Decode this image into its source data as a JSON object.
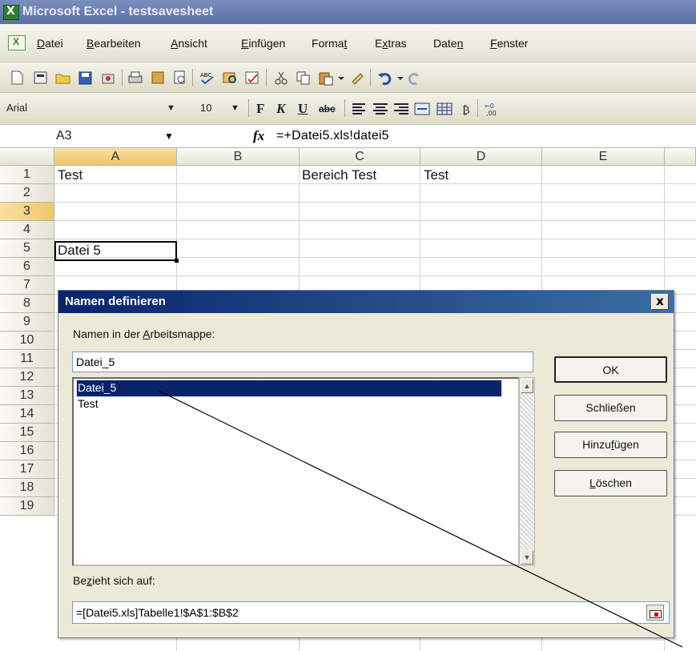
{
  "window": {
    "title": "Microsoft Excel - testsavesheet"
  },
  "menu": {
    "items": [
      {
        "pre": "",
        "key": "D",
        "post": "atei"
      },
      {
        "pre": "",
        "key": "B",
        "post": "earbeiten"
      },
      {
        "pre": "",
        "key": "A",
        "post": "nsicht"
      },
      {
        "pre": "",
        "key": "E",
        "post": "infügen"
      },
      {
        "pre": "Forma",
        "key": "t",
        "post": ""
      },
      {
        "pre": "E",
        "key": "x",
        "post": "tras"
      },
      {
        "pre": "Date",
        "key": "n",
        "post": ""
      },
      {
        "pre": "",
        "key": "F",
        "post": "enster"
      }
    ]
  },
  "format_toolbar": {
    "font": "Arial",
    "size": "10",
    "bold": "F",
    "italic": "K",
    "underline": "U",
    "strike": "abc"
  },
  "formula_bar": {
    "name_box": "A3",
    "fx": "fx",
    "formula": "=+Datei5.xls!datei5"
  },
  "grid": {
    "columns": [
      "A",
      "B",
      "C",
      "D",
      "E"
    ],
    "rows": [
      "1",
      "2",
      "3",
      "4",
      "5",
      "6",
      "7",
      "8",
      "9",
      "10",
      "11",
      "12",
      "13",
      "14",
      "15",
      "16",
      "17",
      "18",
      "19"
    ],
    "cells": {
      "A1": "Test",
      "C1": "Bereich Test",
      "D1": "Test",
      "A3": "Datei 5"
    }
  },
  "dialog": {
    "title": "Namen definieren",
    "close": "x",
    "names_label": {
      "pre": "Namen in der ",
      "key": "A",
      "post": "rbeitsmappe:"
    },
    "name_value": "Datei_5",
    "names": [
      "Datei_5",
      "Test"
    ],
    "selected_index": 0,
    "buttons": {
      "ok": {
        "pre": "OK",
        "key": "",
        "post": ""
      },
      "close": {
        "pre": "Schließen",
        "key": "",
        "post": ""
      },
      "add": {
        "pre": "Hinzu",
        "key": "f",
        "post": "ügen"
      },
      "delete": {
        "pre": "",
        "key": "L",
        "post": "öschen"
      }
    },
    "refers_label": {
      "pre": "Be",
      "key": "z",
      "post": "ieht sich auf:"
    },
    "refers_value": "=[Datei5.xls]Tabelle1!$A$1:$B$2"
  },
  "colors": {
    "title_bar": "#5a6fa3",
    "dialog_title": "#0a246a",
    "selection": "#0a246a",
    "active_header": "#f0c56b"
  }
}
